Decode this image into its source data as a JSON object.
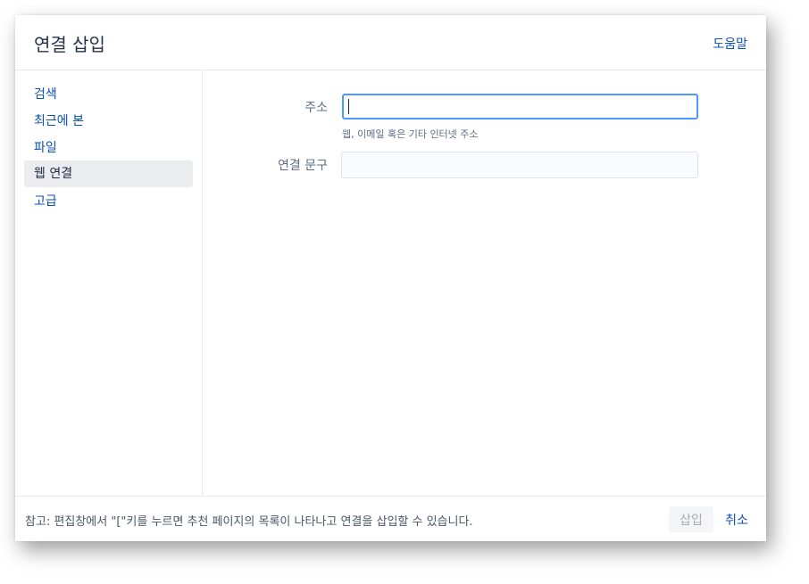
{
  "dialog": {
    "title": "연결 삽입",
    "help_label": "도움말"
  },
  "sidebar": {
    "items": [
      {
        "label": "검색",
        "active": false
      },
      {
        "label": "최근에 본",
        "active": false
      },
      {
        "label": "파일",
        "active": false
      },
      {
        "label": "웹 연결",
        "active": true
      },
      {
        "label": "고급",
        "active": false
      }
    ]
  },
  "form": {
    "address_label": "주소",
    "address_value": "",
    "address_hint": "웹, 이메일 혹은 기타 인터넷 주소",
    "link_text_label": "연결 문구",
    "link_text_value": ""
  },
  "footer": {
    "note": "참고: 편집창에서 \"[\"키를 누르면 추천 페이지의 목록이 나타나고 연결을 삽입할 수 있습니다.",
    "insert_label": "삽입",
    "cancel_label": "취소"
  },
  "colors": {
    "link": "#0b50b3",
    "focus_border": "#4c9aff",
    "active_nav_bg": "#ebecf0"
  }
}
